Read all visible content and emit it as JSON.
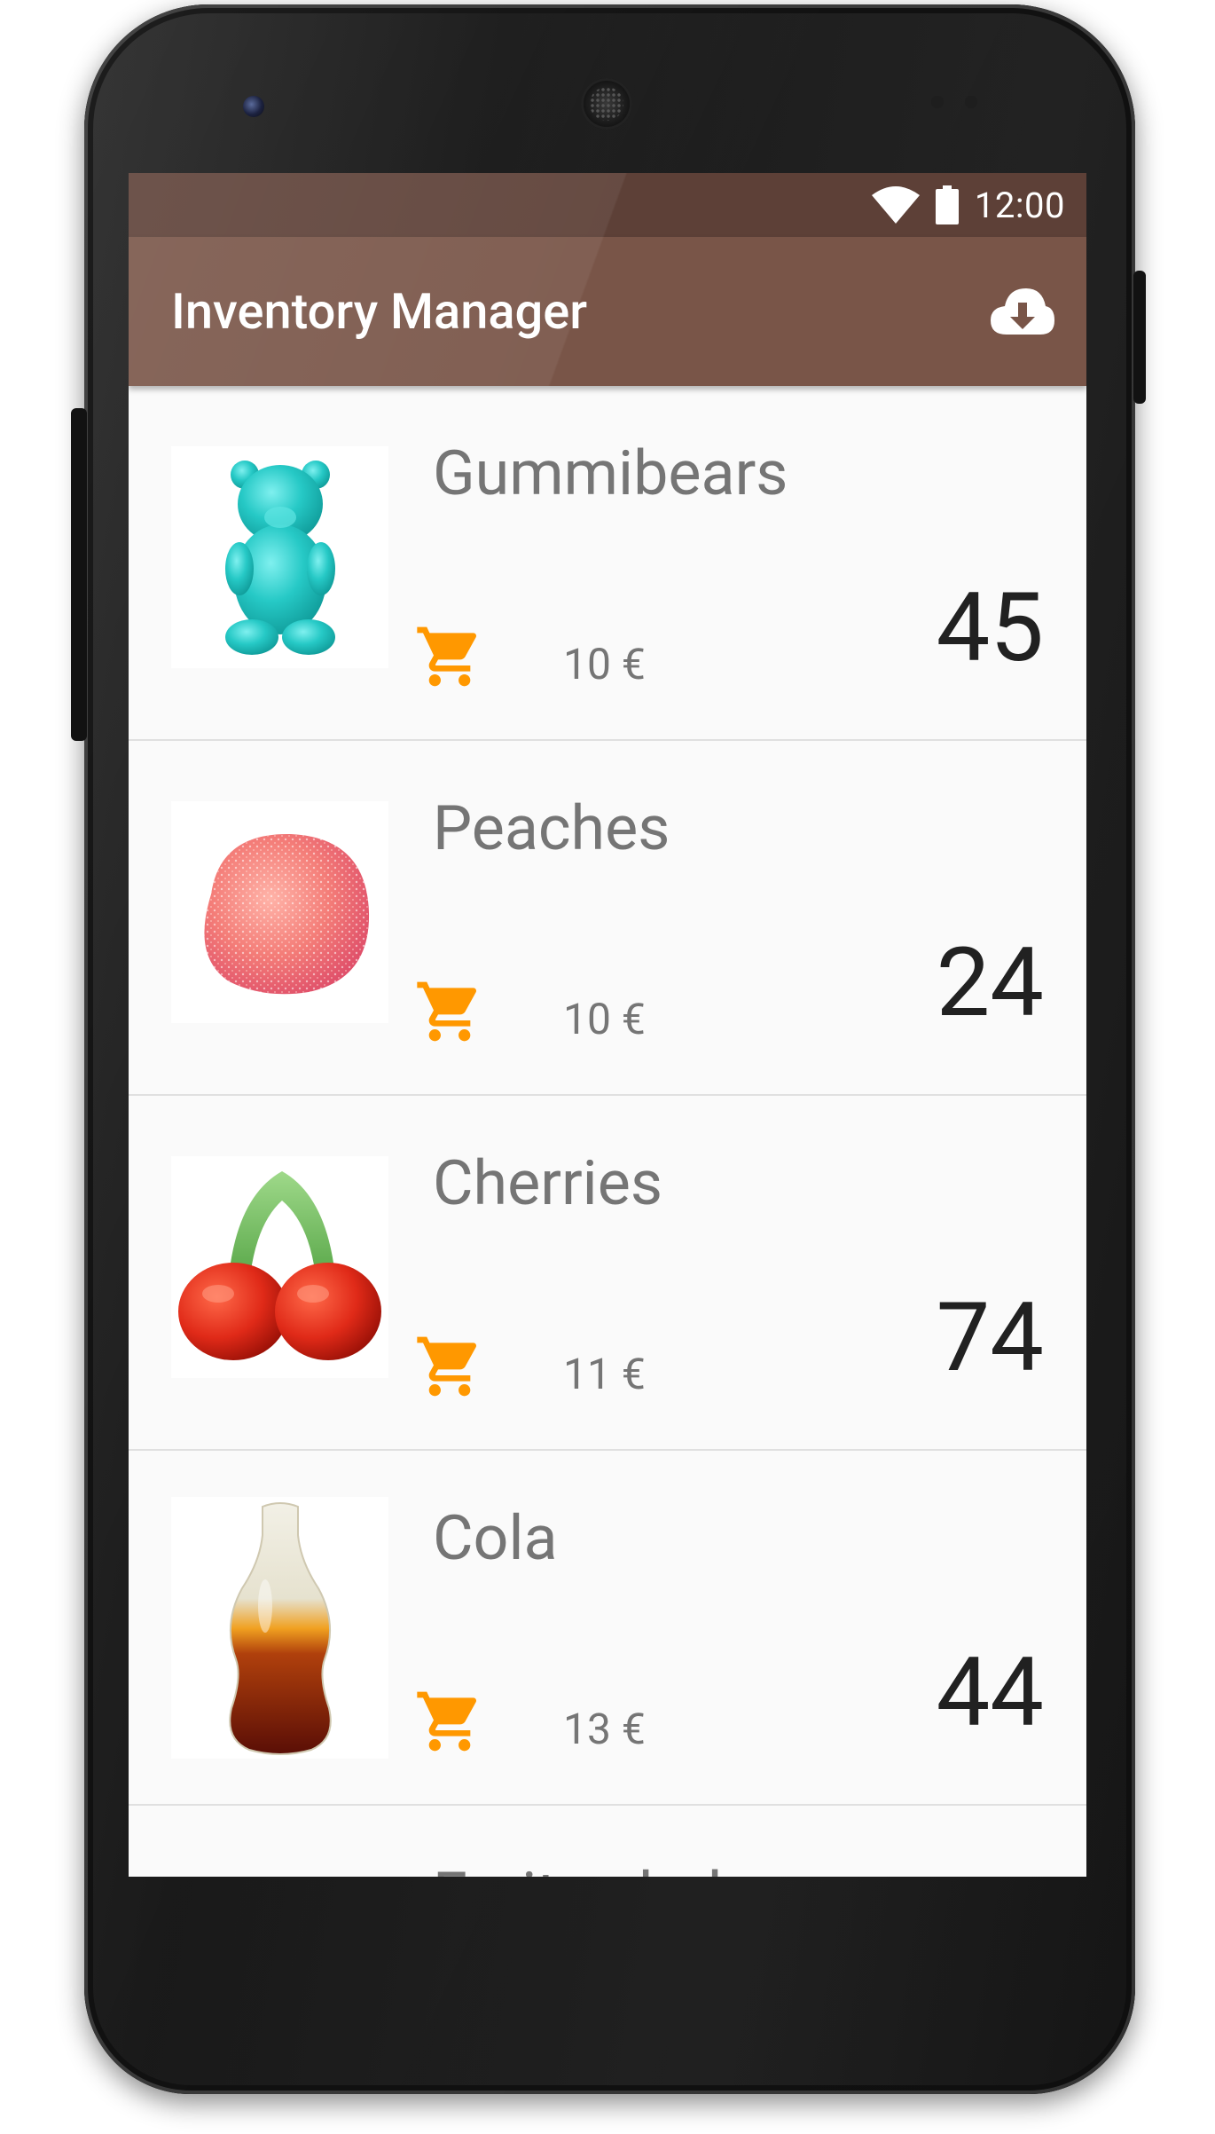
{
  "status_bar": {
    "time": "12:00",
    "wifi_icon": "wifi-icon",
    "battery_icon": "battery-icon"
  },
  "app_bar": {
    "title": "Inventory Manager",
    "action_icon": "cloud-download-icon"
  },
  "colors": {
    "primary": "#795548",
    "primary_dark": "#5d4037",
    "accent": "#ff9800"
  },
  "products": [
    {
      "name": "Gummibears",
      "price": "10 €",
      "quantity": "45",
      "image": "gummy-bear-image"
    },
    {
      "name": "Peaches",
      "price": "10 €",
      "quantity": "24",
      "image": "peach-gummy-image"
    },
    {
      "name": "Cherries",
      "price": "11 €",
      "quantity": "74",
      "image": "cherry-gummy-image"
    },
    {
      "name": "Cola",
      "price": "13 €",
      "quantity": "44",
      "image": "cola-bottle-gummy-image"
    }
  ],
  "partial_item": {
    "name": "Fruit salad"
  }
}
